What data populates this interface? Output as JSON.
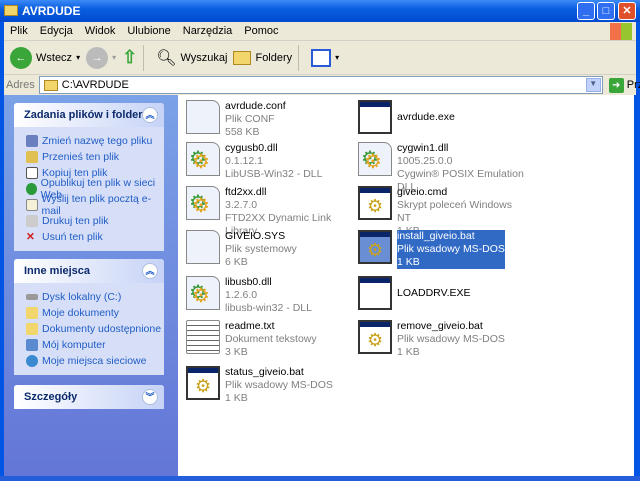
{
  "window": {
    "title": "AVRDUDE"
  },
  "menu": [
    "Plik",
    "Edycja",
    "Widok",
    "Ulubione",
    "Narzędzia",
    "Pomoc"
  ],
  "toolbar": {
    "back": "Wstecz",
    "search": "Wyszukaj",
    "folders": "Foldery"
  },
  "address": {
    "label": "Adres",
    "value": "C:\\AVRDUDE",
    "go": "Przejdź"
  },
  "panels": {
    "tasks": {
      "title": "Zadania plików i folderów",
      "items": [
        "Zmień nazwę tego pliku",
        "Przenieś ten plik",
        "Kopiuj ten plik",
        "Opublikuj ten plik w sieci Web",
        "Wyślij ten plik pocztą e-mail",
        "Drukuj ten plik",
        "Usuń ten plik"
      ]
    },
    "places": {
      "title": "Inne miejsca",
      "items": [
        "Dysk lokalny (C:)",
        "Moje dokumenty",
        "Dokumenty udostępnione",
        "Mój komputer",
        "Moje miejsca sieciowe"
      ]
    },
    "details": {
      "title": "Szczegóły"
    }
  },
  "files": [
    {
      "name": "avrdude.conf",
      "type": "Plik CONF",
      "info": "558 KB",
      "icon": "doc"
    },
    {
      "name": "avrdude.exe",
      "type": "",
      "info": "",
      "icon": "win"
    },
    {
      "name": "cygusb0.dll",
      "type": "0.1.12.1",
      "info": "LibUSB-Win32 - DLL",
      "icon": "dll"
    },
    {
      "name": "cygwin1.dll",
      "type": "1005.25.0.0",
      "info": "Cygwin® POSIX Emulation DLL",
      "icon": "dll"
    },
    {
      "name": "ftd2xx.dll",
      "type": "3.2.7.0",
      "info": "FTD2XX Dynamic Link Library",
      "icon": "dll"
    },
    {
      "name": "giveio.cmd",
      "type": "Skrypt poleceń Windows NT",
      "info": "1 KB",
      "icon": "gear"
    },
    {
      "name": "GIVEIO.SYS",
      "type": "Plik systemowy",
      "info": "6 KB",
      "icon": "sys"
    },
    {
      "name": "install_giveio.bat",
      "type": "Plik wsadowy MS-DOS",
      "info": "1 KB",
      "icon": "gear",
      "selected": true
    },
    {
      "name": "libusb0.dll",
      "type": "1.2.6.0",
      "info": "libusb-win32 - DLL",
      "icon": "dll"
    },
    {
      "name": "LOADDRV.EXE",
      "type": "",
      "info": "",
      "icon": "win"
    },
    {
      "name": "readme.txt",
      "type": "Dokument tekstowy",
      "info": "3 KB",
      "icon": "txt"
    },
    {
      "name": "remove_giveio.bat",
      "type": "Plik wsadowy MS-DOS",
      "info": "1 KB",
      "icon": "gear"
    },
    {
      "name": "status_giveio.bat",
      "type": "Plik wsadowy MS-DOS",
      "info": "1 KB",
      "icon": "gear"
    }
  ]
}
